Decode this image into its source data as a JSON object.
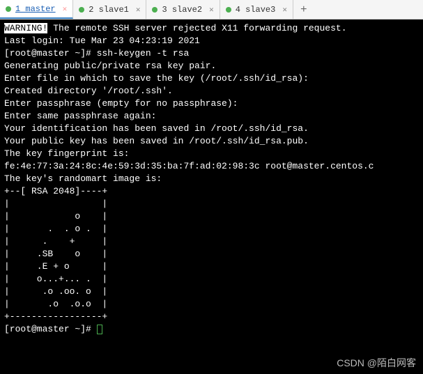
{
  "tabs": [
    {
      "label": "1 master",
      "active": true
    },
    {
      "label": "2 slave1",
      "active": false
    },
    {
      "label": "3 slave2",
      "active": false
    },
    {
      "label": "4 slave3",
      "active": false
    }
  ],
  "add_tab": "+",
  "terminal": {
    "warn_label": "WARNING!",
    "warn_rest": " The remote SSH server rejected X11 forwarding request.",
    "lines": [
      "Last login: Tue Mar 23 04:23:19 2021",
      "[root@master ~]# ssh-keygen -t rsa",
      "Generating public/private rsa key pair.",
      "Enter file in which to save the key (/root/.ssh/id_rsa):",
      "Created directory '/root/.ssh'.",
      "Enter passphrase (empty for no passphrase):",
      "Enter same passphrase again:",
      "Your identification has been saved in /root/.ssh/id_rsa.",
      "Your public key has been saved in /root/.ssh/id_rsa.pub.",
      "The key fingerprint is:",
      "fe:4e:77:3a:24:8c:4e:59:3d:35:ba:7f:ad:02:98:3c root@master.centos.c",
      "The key's randomart image is:",
      "+--[ RSA 2048]----+",
      "|                 |",
      "|            o    |",
      "|       .  . o .  |",
      "|      .    +     |",
      "|     .SB    o    |",
      "|     .E + o      |",
      "|     o...+... .  |",
      "|      .o .oo. o  |",
      "|       .o  .o.o  |",
      "+-----------------+"
    ],
    "prompt": "[root@master ~]# "
  },
  "watermark": "CSDN @陌白网客"
}
